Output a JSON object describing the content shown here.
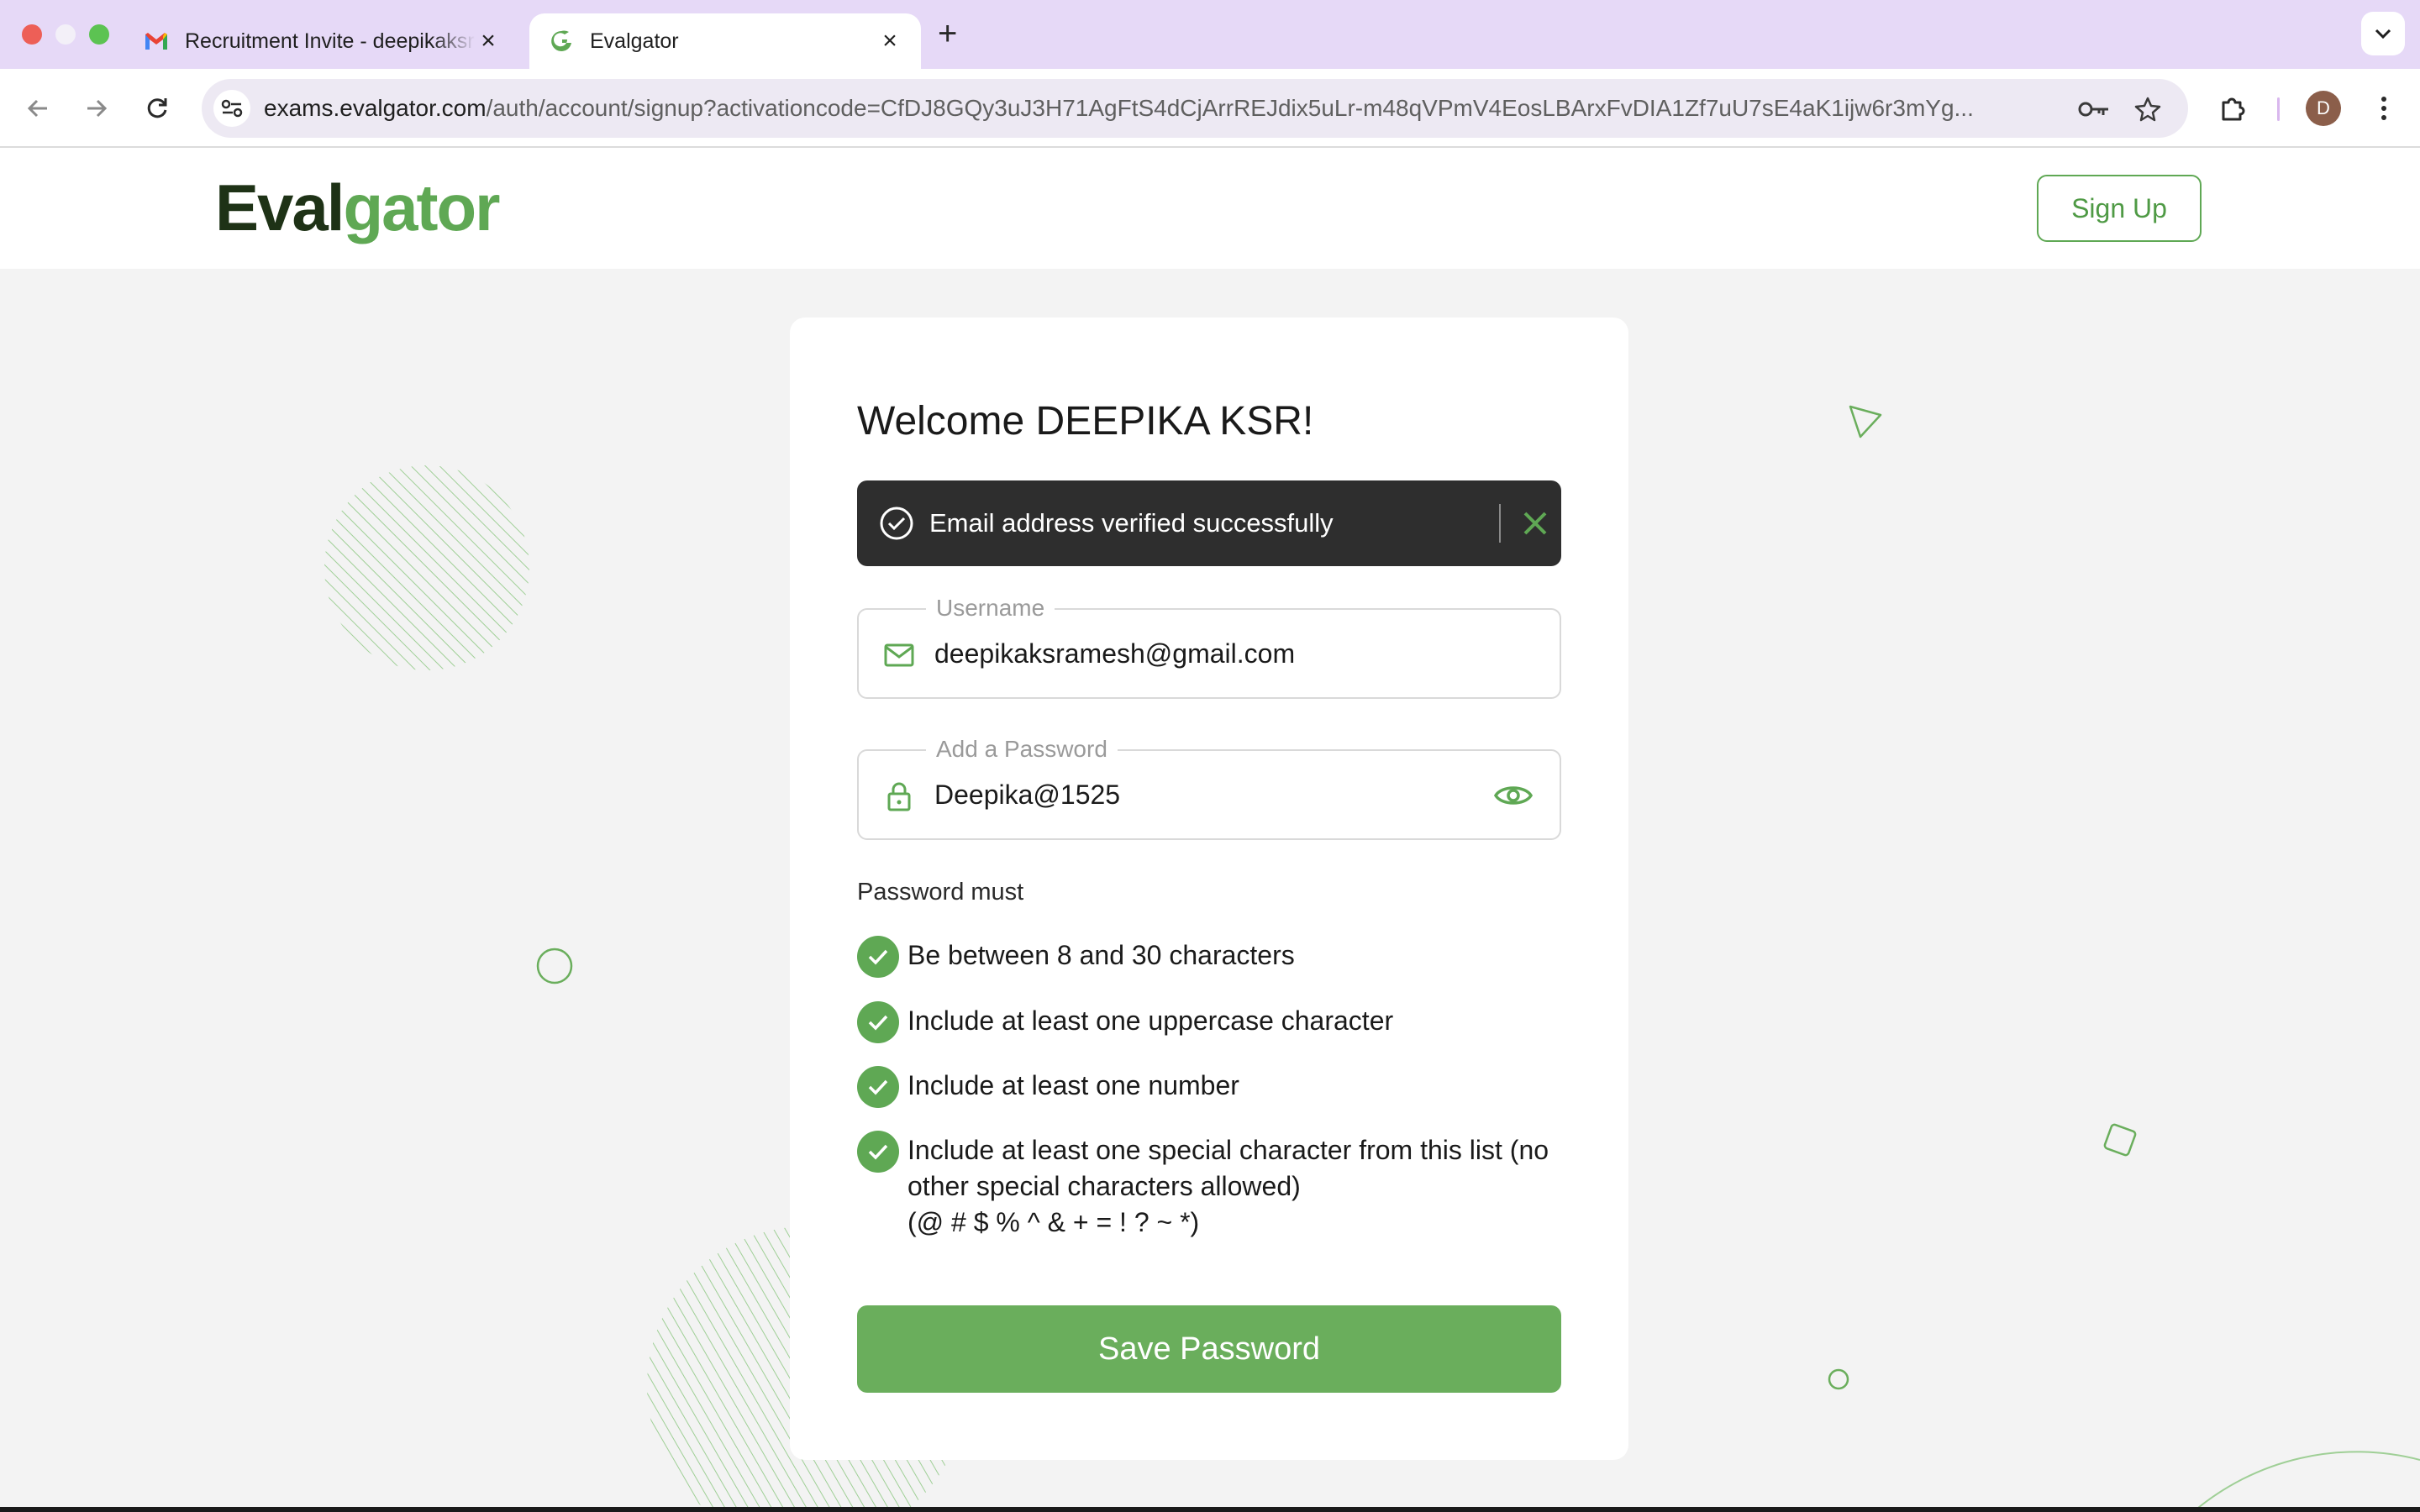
{
  "browser": {
    "tabs": [
      {
        "title": "Recruitment Invite - deepikaksramesh@gmail.com",
        "icon": "gmail-icon",
        "active": false
      },
      {
        "title": "Evalgator",
        "icon": "evalgator-favicon",
        "active": true
      }
    ],
    "url_host": "exams.evalgator.com",
    "url_path": "/auth/account/signup?activationcode=CfDJ8GQy3uJ3H71AgFtS4dCjArrREJdix5uLr-m48qVPmV4EosLBArxFvDIA1Zf7uU7sE4aK1ijw6r3mYg...",
    "profile_initial": "D"
  },
  "header": {
    "logo_part1": "Eval",
    "logo_part2": "gator",
    "signup_label": "Sign Up"
  },
  "card": {
    "welcome": "Welcome DEEPIKA KSR!",
    "toast_message": "Email address verified successfully",
    "username_label": "Username",
    "username_value": "deepikaksramesh@gmail.com",
    "password_label": "Add a Password",
    "password_value": "Deepika@1525",
    "rules_heading": "Password must",
    "rules": [
      {
        "text": "Be between 8 and 30 characters",
        "met": true
      },
      {
        "text": "Include at least one uppercase character",
        "met": true
      },
      {
        "text": "Include at least one number",
        "met": true
      },
      {
        "text": "Include at least one special character from this list (no other special characters allowed)",
        "sub": "(@ # $ % ^ & + = ! ? ~ *)",
        "met": true
      }
    ],
    "save_label": "Save Password"
  },
  "colors": {
    "brand_green": "#5fa854",
    "brand_dark": "#1e3216",
    "tab_strip": "#e6d9f7",
    "toast_bg": "#2e2e2e"
  }
}
